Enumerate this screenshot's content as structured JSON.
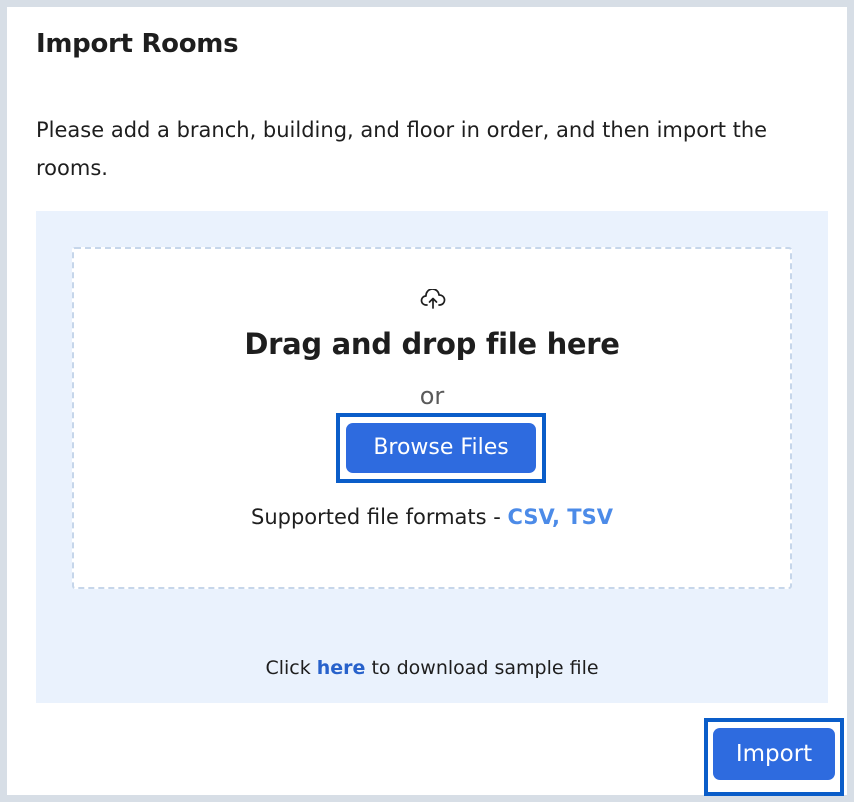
{
  "dialog": {
    "title": "Import Rooms",
    "description": "Please add a branch, building, and floor in order, and then import the rooms."
  },
  "dropzone": {
    "icon": "cloud-upload-icon",
    "drag_text": "Drag and drop file here",
    "or_text": "or",
    "browse_label": "Browse Files",
    "formats_prefix": "Supported file formats - ",
    "formats": "CSV, TSV"
  },
  "sample": {
    "prefix": "Click ",
    "link": "here",
    "suffix": " to download sample file"
  },
  "footer": {
    "import_label": "Import"
  },
  "colors": {
    "accent": "#2e6bdf",
    "focus_ring": "#0a5dc9",
    "upload_area_bg": "#eaf2fd",
    "format_text": "#4c8be8",
    "link": "#2862cb"
  }
}
